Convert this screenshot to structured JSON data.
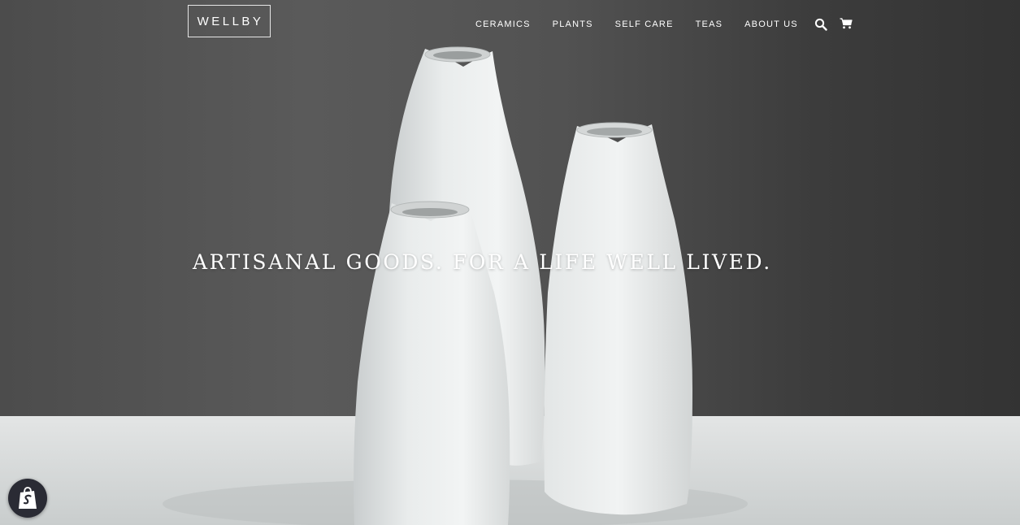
{
  "brand": {
    "logo_text": "WELLBY"
  },
  "nav": {
    "items": [
      {
        "label": "CERAMICS"
      },
      {
        "label": "PLANTS"
      },
      {
        "label": "SELF CARE"
      },
      {
        "label": "TEAS"
      },
      {
        "label": "ABOUT US"
      }
    ],
    "icons": [
      "search-icon",
      "cart-icon"
    ]
  },
  "hero": {
    "tagline": "ARTISANAL GOODS. FOR A LIFE WELL LIVED."
  },
  "badge": {
    "icon": "shopify-bag-icon"
  },
  "colors": {
    "text": "#ffffff",
    "background_wall": "#4f4f4f",
    "table_surface": "#d9dcdc",
    "vase": "#eef0f0",
    "badge_bg": "#2a2b34"
  }
}
